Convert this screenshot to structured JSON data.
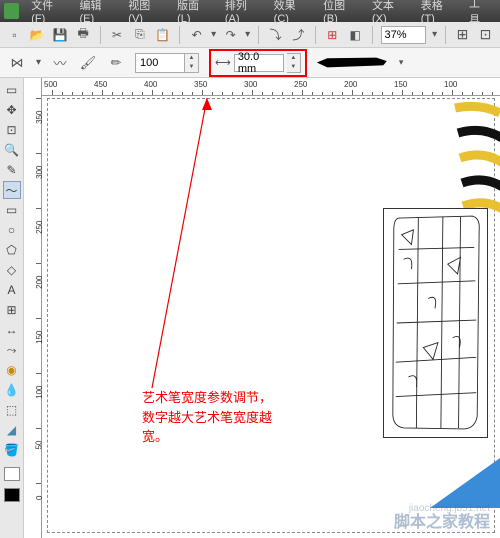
{
  "menu": {
    "file": "文件(F)",
    "edit": "编辑(E)",
    "view": "视图(V)",
    "layout": "版面(L)",
    "arrange": "排列(A)",
    "effects": "效果(C)",
    "position": "位图(B)",
    "text": "文本(X)",
    "table": "表格(T)",
    "tools": "工具"
  },
  "toolbar": {
    "zoom": "37%"
  },
  "props": {
    "value1": "100",
    "width_value": "30.0 mm"
  },
  "ruler_h": [
    "500",
    "450",
    "400",
    "350",
    "300",
    "250",
    "200",
    "150",
    "100"
  ],
  "ruler_v": [
    "350",
    "300",
    "250",
    "200",
    "150",
    "100",
    "50",
    "0"
  ],
  "annotation": {
    "line1": "艺术笔宽度参数调节，",
    "line2": "数字越大艺术笔宽度越",
    "line3": "宽。"
  },
  "watermark": {
    "main": "脚本之家教程",
    "sub": "jiaocheng.jb51.net"
  }
}
